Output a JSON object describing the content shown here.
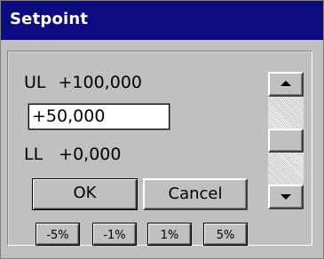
{
  "window": {
    "title": "Setpoint",
    "title_bar_color": "#0c0c80",
    "face_color": "#c0c0c0"
  },
  "limits": {
    "upper_label": "UL",
    "upper_value": "+100,000",
    "lower_label": "LL",
    "lower_value": "+0,000"
  },
  "setpoint_input": {
    "value": "+50,000"
  },
  "buttons": {
    "ok_label": "OK",
    "cancel_label": "Cancel"
  },
  "step_buttons": [
    {
      "label": "-5%"
    },
    {
      "label": "-1%"
    },
    {
      "label": "1%"
    },
    {
      "label": "5%"
    }
  ],
  "scrollbar": {
    "up_icon": "arrow-up-icon",
    "down_icon": "arrow-down-icon",
    "thumb_position_fraction": 0.5
  }
}
